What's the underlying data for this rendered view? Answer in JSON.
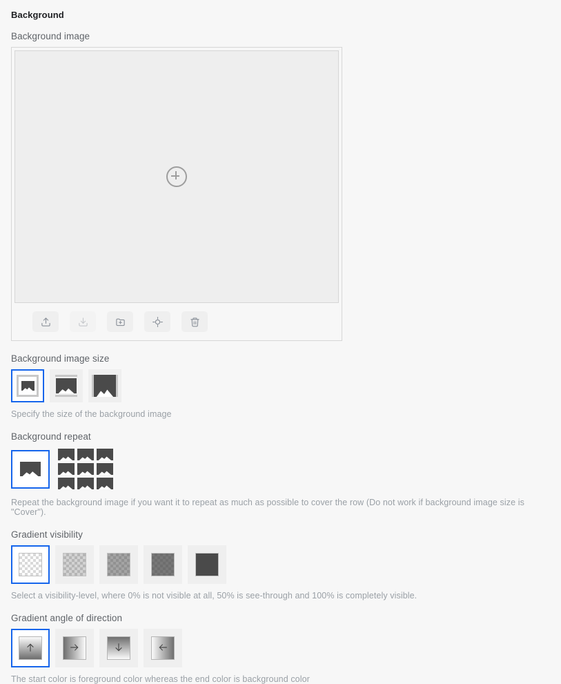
{
  "section": {
    "title": "Background"
  },
  "background_image": {
    "label": "Background image",
    "placeholder_icon": "plus-circle-icon",
    "toolbar": [
      {
        "name": "upload-button",
        "icon": "upload-icon",
        "disabled": false
      },
      {
        "name": "download-button",
        "icon": "download-icon",
        "disabled": true
      },
      {
        "name": "open-folder-button",
        "icon": "folder-plus-icon",
        "disabled": false
      },
      {
        "name": "locate-button",
        "icon": "crosshair-icon",
        "disabled": false
      },
      {
        "name": "delete-button",
        "icon": "trash-icon",
        "disabled": false
      }
    ]
  },
  "background_image_size": {
    "label": "Background image size",
    "help": "Specify the size of the background image",
    "options": [
      {
        "name": "size-auto",
        "icon": "image-small-icon"
      },
      {
        "name": "size-contain",
        "icon": "image-medium-icon"
      },
      {
        "name": "size-cover",
        "icon": "image-large-icon"
      }
    ],
    "selected_index": 0
  },
  "background_repeat": {
    "label": "Background repeat",
    "help": "Repeat the background image if you want it to repeat as much as possible to cover the row (Do not work if background image size is \"Cover\").",
    "options": [
      {
        "name": "repeat-no-repeat",
        "icon": "image-single-icon"
      },
      {
        "name": "repeat-tiled",
        "icon": "image-grid-icon"
      }
    ],
    "selected_index": 0
  },
  "gradient_visibility": {
    "label": "Gradient visibility",
    "help": "Select a visibility-level, where 0% is not visible at all, 50% is see-through and 100% is completely visible.",
    "options": [
      {
        "name": "visibility-0",
        "value": "0%",
        "opacity": 0
      },
      {
        "name": "visibility-25",
        "value": "25%",
        "opacity": 0.25
      },
      {
        "name": "visibility-50",
        "value": "50%",
        "opacity": 0.5
      },
      {
        "name": "visibility-75",
        "value": "75%",
        "opacity": 0.75
      },
      {
        "name": "visibility-100",
        "value": "100%",
        "opacity": 1
      }
    ],
    "selected_index": 0,
    "swatch_color": "#4a4a4a"
  },
  "gradient_angle": {
    "label": "Gradient angle of direction",
    "help": "The start color is foreground color whereas the end color is background color",
    "options": [
      {
        "name": "angle-up",
        "icon": "arrow-up-icon",
        "direction": "to top"
      },
      {
        "name": "angle-right",
        "icon": "arrow-right-icon",
        "direction": "to right"
      },
      {
        "name": "angle-down",
        "icon": "arrow-down-icon",
        "direction": "to bottom"
      },
      {
        "name": "angle-left",
        "icon": "arrow-left-icon",
        "direction": "to left"
      }
    ],
    "selected_index": 0
  },
  "colors": {
    "accent": "#1565ec",
    "label": "#5f6368",
    "help": "#9aa0a6",
    "tile_bg": "#efefef",
    "page_bg": "#f7f7f7"
  }
}
